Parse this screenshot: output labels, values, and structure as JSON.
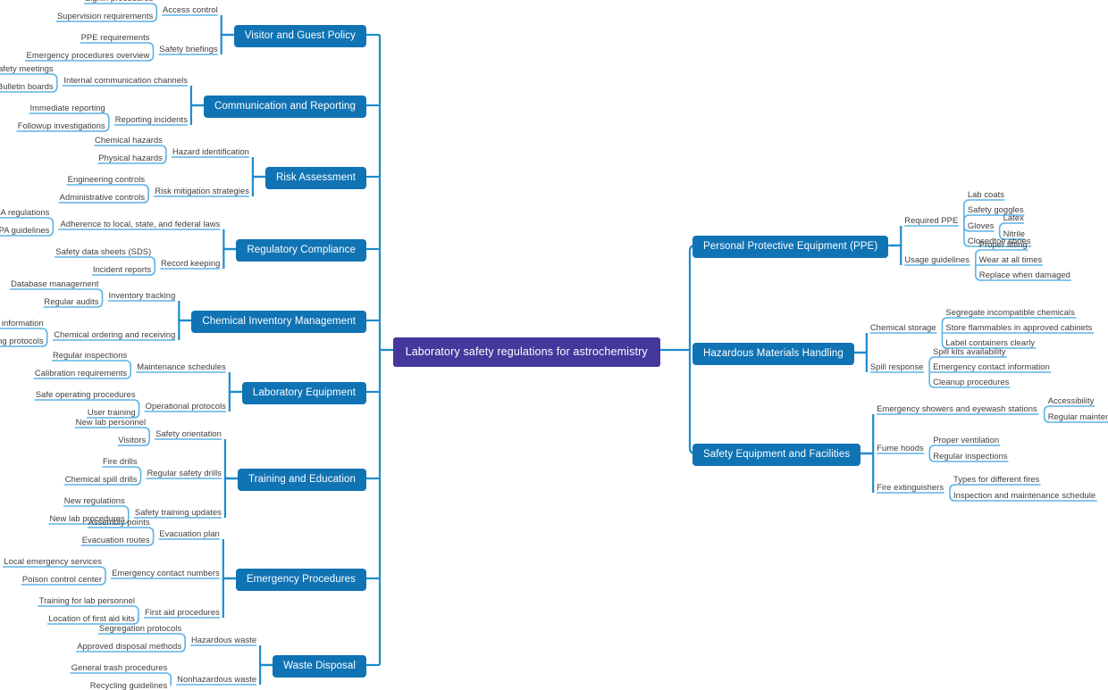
{
  "diagram": {
    "type": "mind-map",
    "root": {
      "label": "Laboratory safety regulations for astrochemistry"
    },
    "colors": {
      "root_fill": "#43389c",
      "branch_fill": "#1073b4",
      "connector": "#1e8bcd",
      "leaf_underline": "#5bb4e5",
      "text": "#3d3d3d",
      "background": "#ffffff"
    },
    "left_branches": [
      {
        "label": "Visitor and Guest Policy",
        "children": [
          {
            "label": "Access control",
            "children": [
              {
                "label": "Signin procedures"
              },
              {
                "label": "Supervision requirements"
              }
            ]
          },
          {
            "label": "Safety briefings",
            "children": [
              {
                "label": "PPE requirements"
              },
              {
                "label": "Emergency procedures overview"
              }
            ]
          }
        ]
      },
      {
        "label": "Communication and Reporting",
        "children": [
          {
            "label": "Internal communication channels",
            "children": [
              {
                "label": "Safety meetings"
              },
              {
                "label": "Bulletin boards"
              }
            ]
          },
          {
            "label": "Reporting incidents",
            "children": [
              {
                "label": "Immediate reporting"
              },
              {
                "label": "Followup investigations"
              }
            ]
          }
        ]
      },
      {
        "label": "Risk Assessment",
        "children": [
          {
            "label": "Hazard identification",
            "children": [
              {
                "label": "Chemical hazards"
              },
              {
                "label": "Physical hazards"
              }
            ]
          },
          {
            "label": "Risk mitigation strategies",
            "children": [
              {
                "label": "Engineering controls"
              },
              {
                "label": "Administrative controls"
              }
            ]
          }
        ]
      },
      {
        "label": "Regulatory Compliance",
        "children": [
          {
            "label": "Adherence to local, state, and federal laws",
            "children": [
              {
                "label": "OSHA regulations"
              },
              {
                "label": "EPA guidelines"
              }
            ]
          },
          {
            "label": "Record keeping",
            "children": [
              {
                "label": "Safety data sheets (SDS)"
              },
              {
                "label": "Incident reports"
              }
            ]
          }
        ]
      },
      {
        "label": "Chemical Inventory Management",
        "children": [
          {
            "label": "Inventory tracking",
            "children": [
              {
                "label": "Database management"
              },
              {
                "label": "Regular audits"
              }
            ]
          },
          {
            "label": "Chemical ordering and receiving",
            "children": [
              {
                "label": "Supplier information"
              },
              {
                "label": "Receiving protocols"
              }
            ]
          }
        ]
      },
      {
        "label": "Laboratory Equipment",
        "children": [
          {
            "label": "Maintenance schedules",
            "children": [
              {
                "label": "Regular inspections"
              },
              {
                "label": "Calibration requirements"
              }
            ]
          },
          {
            "label": "Operational protocols",
            "children": [
              {
                "label": "Safe operating procedures"
              },
              {
                "label": "User training"
              }
            ]
          }
        ]
      },
      {
        "label": "Training and Education",
        "children": [
          {
            "label": "Safety orientation",
            "children": [
              {
                "label": "New lab personnel"
              },
              {
                "label": "Visitors"
              }
            ]
          },
          {
            "label": "Regular safety drills",
            "children": [
              {
                "label": "Fire drills"
              },
              {
                "label": "Chemical spill drills"
              }
            ]
          },
          {
            "label": "Safety training updates",
            "children": [
              {
                "label": "New regulations"
              },
              {
                "label": "New lab procedures"
              }
            ]
          }
        ]
      },
      {
        "label": "Emergency Procedures",
        "children": [
          {
            "label": "Evacuation plan",
            "children": [
              {
                "label": "Assembly points"
              },
              {
                "label": "Evacuation routes"
              }
            ]
          },
          {
            "label": "Emergency contact numbers",
            "children": [
              {
                "label": "Local emergency services"
              },
              {
                "label": "Poison control center"
              }
            ]
          },
          {
            "label": "First aid procedures",
            "children": [
              {
                "label": "Training for lab personnel"
              },
              {
                "label": "Location of first aid kits"
              }
            ]
          }
        ]
      },
      {
        "label": "Waste Disposal",
        "children": [
          {
            "label": "Hazardous waste",
            "children": [
              {
                "label": "Segregation protocols"
              },
              {
                "label": "Approved disposal methods"
              }
            ]
          },
          {
            "label": "Nonhazardous waste",
            "children": [
              {
                "label": "General trash procedures"
              },
              {
                "label": "Recycling guidelines"
              }
            ]
          }
        ]
      }
    ],
    "right_branches": [
      {
        "label": "Personal Protective Equipment (PPE)",
        "children": [
          {
            "label": "Required PPE",
            "children": [
              {
                "label": "Lab coats"
              },
              {
                "label": "Safety goggles"
              },
              {
                "label": "Gloves",
                "children": [
                  {
                    "label": "Latex"
                  },
                  {
                    "label": "Nitrile"
                  }
                ]
              },
              {
                "label": "Closedtoe shoes"
              }
            ]
          },
          {
            "label": "Usage guidelines",
            "children": [
              {
                "label": "Proper fitting"
              },
              {
                "label": "Wear at all times"
              },
              {
                "label": "Replace when damaged"
              }
            ]
          }
        ]
      },
      {
        "label": "Hazardous Materials Handling",
        "children": [
          {
            "label": "Chemical storage",
            "children": [
              {
                "label": "Segregate incompatible chemicals"
              },
              {
                "label": "Store flammables in approved cabinets"
              },
              {
                "label": "Label containers clearly"
              }
            ]
          },
          {
            "label": "Spill response",
            "children": [
              {
                "label": "Spill kits availability"
              },
              {
                "label": "Emergency contact information"
              },
              {
                "label": "Cleanup procedures"
              }
            ]
          }
        ]
      },
      {
        "label": "Safety Equipment and Facilities",
        "children": [
          {
            "label": "Emergency showers and eyewash stations",
            "children": [
              {
                "label": "Accessibility"
              },
              {
                "label": "Regular maintenance checks"
              }
            ]
          },
          {
            "label": "Fume hoods",
            "children": [
              {
                "label": "Proper ventilation"
              },
              {
                "label": "Regular inspections"
              }
            ]
          },
          {
            "label": "Fire extinguishers",
            "children": [
              {
                "label": "Types for different fires"
              },
              {
                "label": "Inspection and maintenance schedule"
              }
            ]
          }
        ]
      }
    ]
  }
}
